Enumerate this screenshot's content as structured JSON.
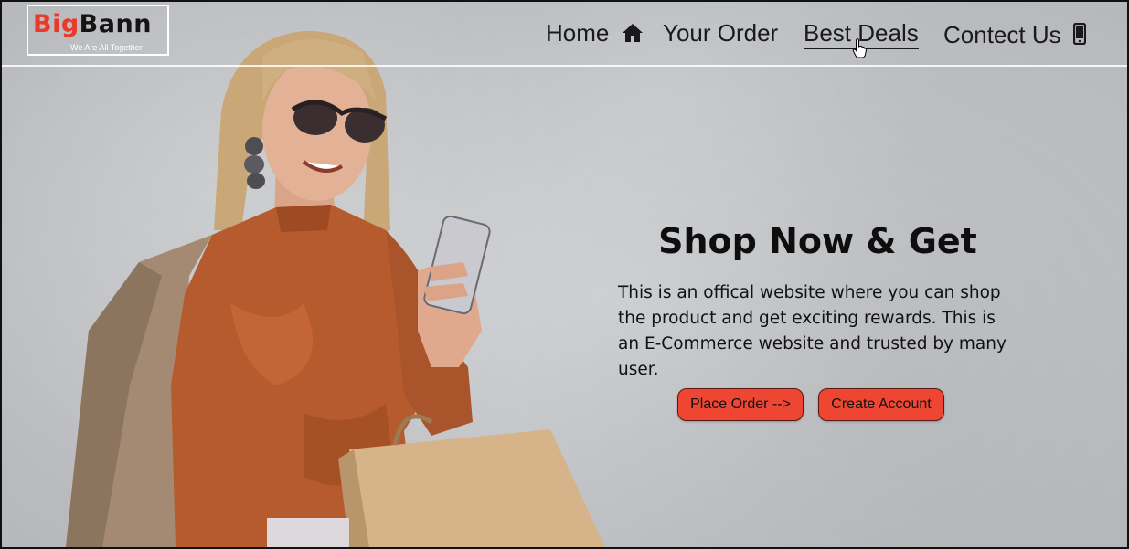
{
  "brand": {
    "name_part1": "Big",
    "name_part2": "Bann",
    "tagline": "We Are All Together"
  },
  "nav": {
    "items": [
      {
        "label": "Home",
        "icon": "home-icon"
      },
      {
        "label": "Your Order",
        "icon": null
      },
      {
        "label": "Best Deals",
        "icon": null,
        "hovered": true
      },
      {
        "label": "Contect Us",
        "icon": "mobile-phone-icon"
      }
    ]
  },
  "hero": {
    "title": "Shop Now & Get",
    "description": "This is an offical website where you can shop the product and get exciting rewards. This is an E-Commerce website and trusted by many user.",
    "buttons": {
      "place_order": "Place Order -->",
      "create_account": "Create Account"
    },
    "image_subject": "woman-with-phone-and-shopping-bags"
  },
  "colors": {
    "accent": "#ee4632",
    "logo_red": "#e8392a",
    "text_dark": "#111111",
    "background": "#c4c6c9"
  }
}
